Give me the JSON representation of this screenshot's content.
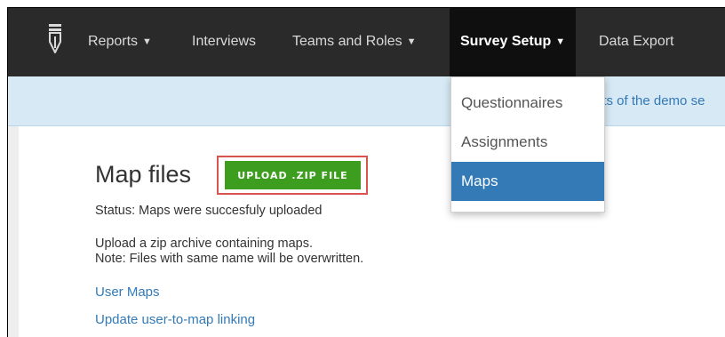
{
  "navbar": {
    "items": [
      {
        "label": "Reports",
        "caret": "▼"
      },
      {
        "label": "Interviews",
        "caret": ""
      },
      {
        "label": "Teams and Roles",
        "caret": "▼"
      },
      {
        "label": "Survey Setup",
        "caret": "▼"
      },
      {
        "label": "Data Export",
        "caret": ""
      }
    ],
    "active_index": 3
  },
  "infobar": {
    "text": "nts of the demo se"
  },
  "dropdown": {
    "items": [
      {
        "label": "Questionnaires"
      },
      {
        "label": "Assignments"
      },
      {
        "label": "Maps"
      }
    ],
    "selected_index": 2
  },
  "main": {
    "title": "Map files",
    "upload_label": "UPLOAD .ZIP FILE",
    "status": "Status: Maps were succesfuly uploaded",
    "help_line1": "Upload a zip archive containing maps.",
    "help_line2": "Note: Files with same name will be overwritten.",
    "links": [
      {
        "label": "User Maps"
      },
      {
        "label": "Update user-to-map linking"
      }
    ]
  },
  "colors": {
    "navbar": "#2a2a2a",
    "active_nav": "#0f0f0f",
    "infobar": "#d6e9f5",
    "link": "#337ab7",
    "upload_button": "#3c9d1f",
    "highlight_border": "#d9534f",
    "dropdown_selected": "#337ab7"
  },
  "icons": {
    "logo": "pen-nib-logo-icon"
  }
}
